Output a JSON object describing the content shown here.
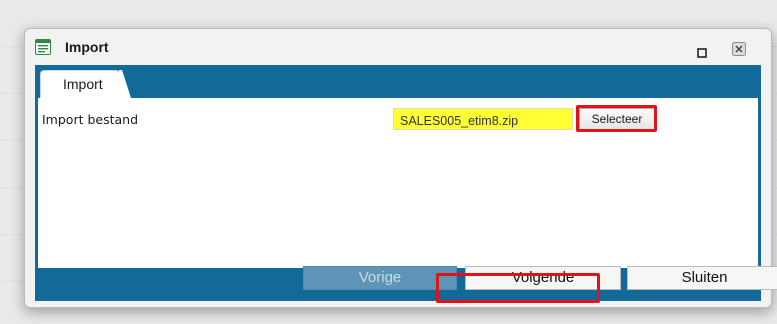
{
  "dialog": {
    "title": "Import",
    "icon": "form-icon",
    "maximize_icon": "maximize-icon",
    "close_icon": "close-icon"
  },
  "tabs": [
    {
      "label": "Import",
      "active": true
    }
  ],
  "form": {
    "field_label": "Import bestand",
    "file_value": "SALES005_etim8.zip",
    "select_button": "Selecteer"
  },
  "footer": {
    "prev_label": "Vorige",
    "next_label": "Volgende",
    "close_label": "Sluiten"
  },
  "colors": {
    "accent": "#14699b",
    "highlight": "#e0121a",
    "file_field_bg": "#ffff33"
  }
}
